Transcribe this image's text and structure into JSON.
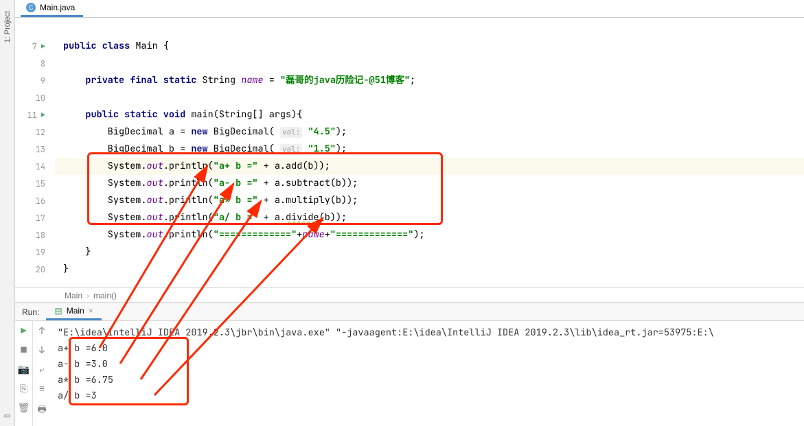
{
  "sidebar": {
    "project_label": "1: Project"
  },
  "tab": {
    "filename": "Main.java"
  },
  "gutter": {
    "lines": [
      "",
      "7",
      "8",
      "9",
      "10",
      "11",
      "12",
      "13",
      "14",
      "15",
      "16",
      "17",
      "18",
      "19",
      "20"
    ]
  },
  "code": {
    "l7_pre": "public class ",
    "l7_cls": "Main",
    "l7_post": " {",
    "l9_pre": "    ",
    "l9_mods": "private final static",
    "l9_type": " String ",
    "l9_var": "name",
    "l9_eq": " = ",
    "l9_str": "\"磊哥的java历险记-@51博客\"",
    "l9_end": ";",
    "l11_pre": "    ",
    "l11_mods": "public static void",
    "l11_sig": " main(String[] args){",
    "l12_ind": "        BigDecimal a = ",
    "l12_new": "new",
    "l12_mid": " BigDecimal( ",
    "l12_hint": "val:",
    "l12_sp": " ",
    "l12_str": "\"4.5\"",
    "l12_end": ");",
    "l13_ind": "        BigDecimal b = ",
    "l13_new": "new",
    "l13_mid": " BigDecimal( ",
    "l13_hint": "val:",
    "l13_sp": " ",
    "l13_str": "\"1.5\"",
    "l13_end": ");",
    "l14_a": "        System.",
    "l14_out": "out",
    "l14_b": ".println(",
    "l14_str": "\"a+ b =\"",
    "l14_c": " + a.add(b));",
    "l15_a": "        System.",
    "l15_out": "out",
    "l15_b": ".println(",
    "l15_str": "\"a- b =\"",
    "l15_c": " + a.subtract(b));",
    "l16_a": "        System.",
    "l16_out": "out",
    "l16_b": ".println(",
    "l16_str": "\"a* b =\"",
    "l16_c": " + a.multiply(b));",
    "l17_a": "        System.",
    "l17_out": "out",
    "l17_b": ".println(",
    "l17_str": "\"a/ b =\"",
    "l17_c": " + a.",
    "l17_div": "divide",
    "l17_d": "(b));",
    "l18_a": "        System.",
    "l18_out": "out",
    "l18_b": ".println(",
    "l18_str": "\"=============\"",
    "l18_c": "+",
    "l18_var": "name",
    "l18_d": "+",
    "l18_str2": "\"=============\"",
    "l18_e": ");",
    "l19": "    }",
    "l20": "}"
  },
  "breadcrumb": {
    "cls": "Main",
    "method": "main()"
  },
  "run": {
    "title": "Run:",
    "config": "Main",
    "cmd": "\"E:\\idea\\IntelliJ IDEA 2019.2.3\\jbr\\bin\\java.exe\" \"-javaagent:E:\\idea\\IntelliJ IDEA 2019.2.3\\lib\\idea_rt.jar=53975:E:\\",
    "out1": "a+ b =6.0",
    "out2": "a- b =3.0",
    "out3": "a* b =6.75",
    "out4": "a/ b =3"
  }
}
